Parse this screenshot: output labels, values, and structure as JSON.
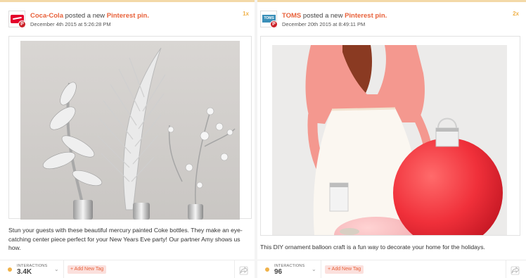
{
  "posts": [
    {
      "brand": "Coca-Cola",
      "action": "posted a new",
      "link": "Pinterest pin.",
      "date": "December 4th 2015 at 5:26:28 PM",
      "rank": "1x",
      "caption": "Stun your guests with these beautiful mercury painted Coke bottles. They make an eye-catching center piece perfect for your New Years Eve party! Our partner Amy shows us how.",
      "interactions_label": "INTERACTIONS",
      "interactions_value": "3.4K",
      "add_tag_label": "+ Add New Tag"
    },
    {
      "brand": "TOMS",
      "action": "posted a new",
      "link": "Pinterest pin.",
      "date": "December 20th 2015 at 8:49:11 PM",
      "rank": "2x",
      "caption": "This DIY ornament balloon craft is a fun way to decorate your home for the holidays.",
      "interactions_label": "INTERACTIONS",
      "interactions_value": "96",
      "add_tag_label": "+ Add New Tag"
    }
  ],
  "logos": {
    "toms": "TOMS"
  },
  "icons": {
    "pinterest_badge": "P",
    "chevron": "⌄"
  },
  "colors": {
    "brand_link": "#e8613a",
    "accent_dot": "#f0b24a",
    "tag_bg": "#fbe0dd",
    "pinterest_red": "#cb2027"
  }
}
